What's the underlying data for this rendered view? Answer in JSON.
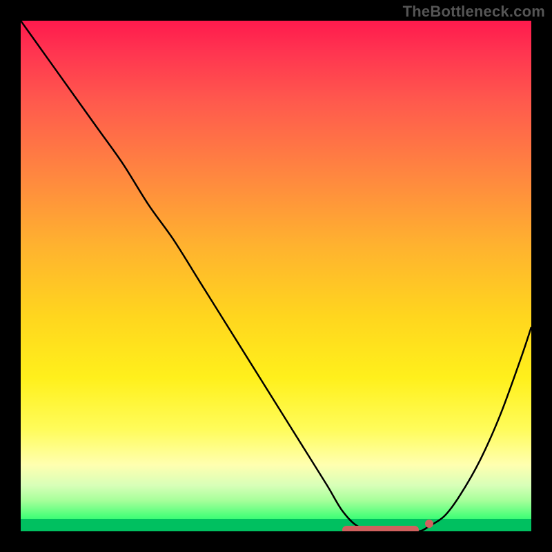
{
  "watermark": "TheBottleneck.com",
  "colors": {
    "curve": "#000000",
    "marker": "#d0615e",
    "border": "#000000"
  },
  "chart_data": {
    "type": "line",
    "title": "",
    "xlabel": "",
    "ylabel": "",
    "xlim": [
      0,
      100
    ],
    "ylim": [
      0,
      100
    ],
    "grid": false,
    "legend": false,
    "background_gradient": {
      "top_color": "#ff1a4d",
      "mid_color": "#ffd61e",
      "bottom_color": "#00e66b"
    },
    "series": [
      {
        "name": "bottleneck-curve",
        "x": [
          0,
          5,
          10,
          15,
          20,
          25,
          30,
          35,
          40,
          45,
          50,
          55,
          60,
          63,
          66,
          70,
          74,
          78,
          80,
          83,
          86,
          90,
          94,
          98,
          100
        ],
        "values": [
          100,
          93,
          86,
          79,
          72,
          64,
          57,
          49,
          41,
          33,
          25,
          17,
          9,
          4,
          1,
          0,
          0,
          0,
          1,
          3,
          7,
          14,
          23,
          34,
          40
        ]
      }
    ],
    "optimal_range": {
      "x_start": 63,
      "x_end": 80
    },
    "annotations": [
      {
        "type": "bar",
        "x_start": 63,
        "x_end": 78,
        "y": 0
      },
      {
        "type": "dot",
        "x": 80,
        "y": 1
      }
    ]
  }
}
